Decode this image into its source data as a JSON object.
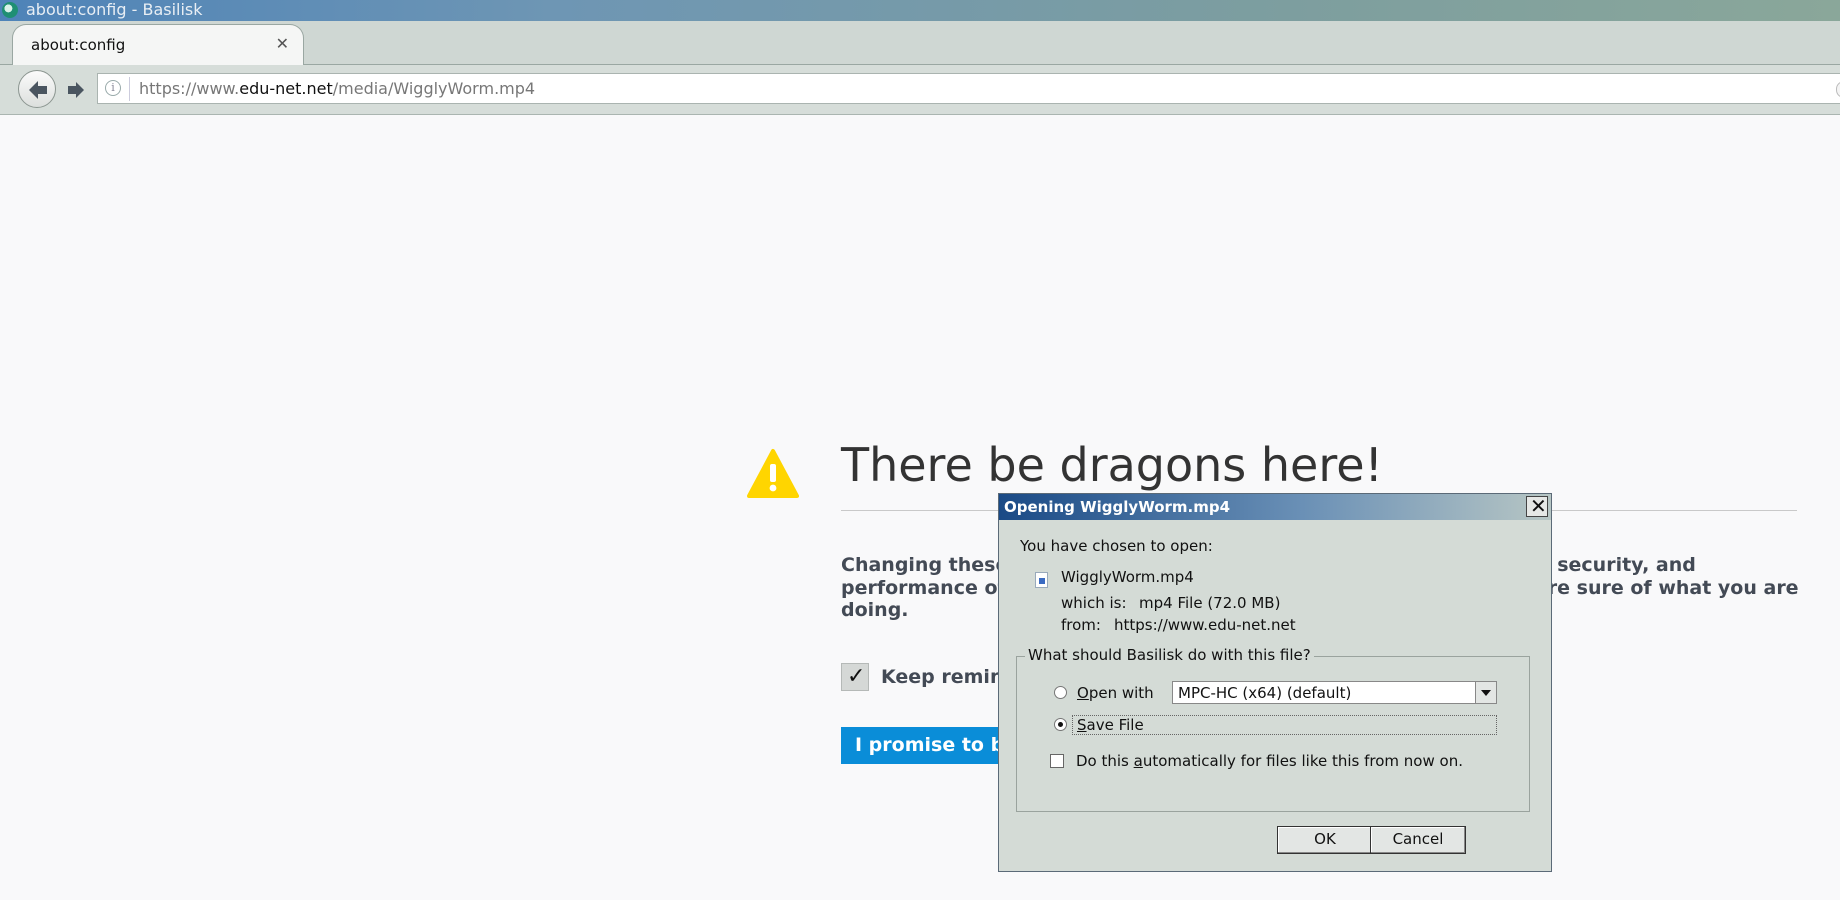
{
  "window": {
    "title": "about:config - Basilisk"
  },
  "tabs": [
    {
      "label": "about:config"
    }
  ],
  "nav": {
    "url_prefix": "https://www.",
    "url_domain": "edu-net.net",
    "url_path": "/media/WigglyWorm.mp4"
  },
  "page": {
    "heading": "There be dragons here!",
    "warning_text": "Changing these advanced settings can be harmful to the stability, security, and performance of this application. You should only continue if you are sure of what you are doing.",
    "warning_visible": "Changing these ▒▒▒▒▒▒▒▒▒▒▒▒▒▒▒▒▒▒▒▒▒▒▒▒▒▒▒▒▒▒▒▒▒▒▒▒ ability, security, operation and p",
    "keep_label": "Keep reminding me",
    "promise_button": "I promise to be careful!"
  },
  "dialog": {
    "title": "Opening WigglyWorm.mp4",
    "chosen_label": "You have chosen to open:",
    "file_name": "WigglyWorm.mp4",
    "which_is_label": "which is:",
    "which_is_value": "mp4 File (72.0 MB)",
    "from_label": "from:",
    "from_value": "https://www.edu-net.net",
    "group_label": "What should Basilisk do with this file?",
    "open_with_label": "Open with",
    "open_with_value": "MPC-HC (x64) (default)",
    "save_file_label": "Save File",
    "auto_label_pre": "Do this ",
    "auto_label_u": "a",
    "auto_label_post": "utomatically for files like this from now on.",
    "ok_label": "OK",
    "cancel_label": "Cancel",
    "selected_option": "save"
  }
}
